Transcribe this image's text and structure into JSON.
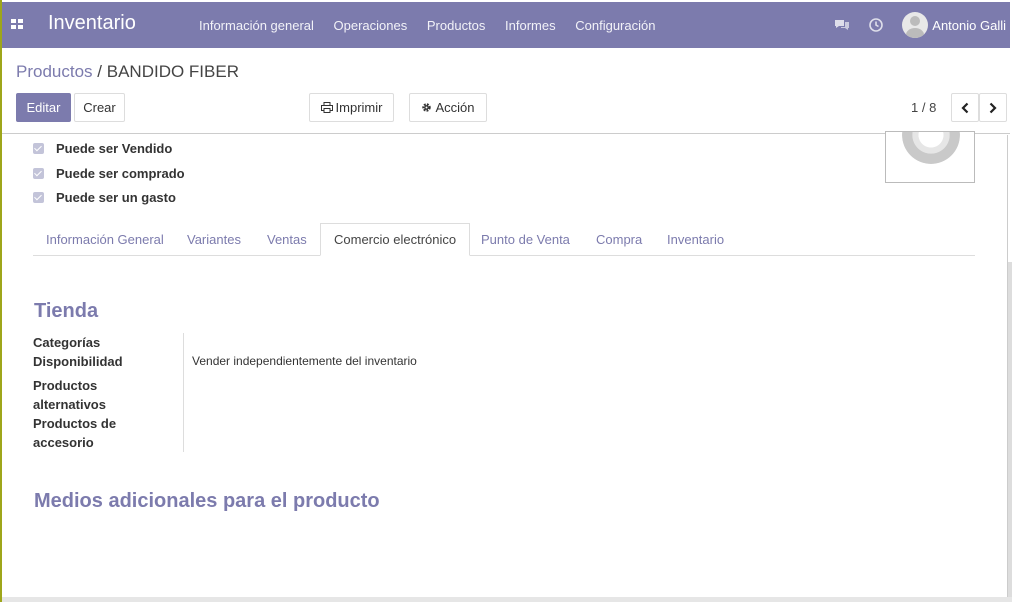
{
  "navbar": {
    "app_title": "Inventario",
    "menu": [
      "Información general",
      "Operaciones",
      "Productos",
      "Informes",
      "Configuración"
    ],
    "user_name": "Antonio Galli",
    "icons": [
      "apps-icon",
      "chat-icon",
      "clock-icon"
    ]
  },
  "breadcrumb": {
    "parent": "Productos",
    "separator": "/",
    "current": "BANDIDO FIBER"
  },
  "buttons": {
    "edit": "Editar",
    "create": "Crear",
    "print": "Imprimir",
    "action": "Acción"
  },
  "pager": {
    "value": "1 / 8"
  },
  "checkboxes": [
    {
      "label": "Puede ser Vendido",
      "checked": true
    },
    {
      "label": "Puede ser comprado",
      "checked": true
    },
    {
      "label": "Puede ser un gasto",
      "checked": true
    }
  ],
  "tabs": [
    {
      "label": "Información General",
      "active": false
    },
    {
      "label": "Variantes",
      "active": false
    },
    {
      "label": "Ventas",
      "active": false
    },
    {
      "label": "Comercio electrónico",
      "active": true
    },
    {
      "label": "Punto de Venta",
      "active": false
    },
    {
      "label": "Compra",
      "active": false
    },
    {
      "label": "Inventario",
      "active": false
    }
  ],
  "shop": {
    "title": "Tienda",
    "labels": {
      "categories": "Categorías",
      "availability": "Disponibilidad",
      "alternative_line1": "Productos",
      "alternative_line2": "alternativos",
      "accessory_line1": "Productos de",
      "accessory_line2": "accesorio"
    },
    "availability_value": "Vender independientemente del inventario"
  },
  "media": {
    "title": "Medios adicionales para el producto"
  },
  "colors": {
    "brand": "#7c7bad",
    "checkbox": "#c3c4d9"
  }
}
